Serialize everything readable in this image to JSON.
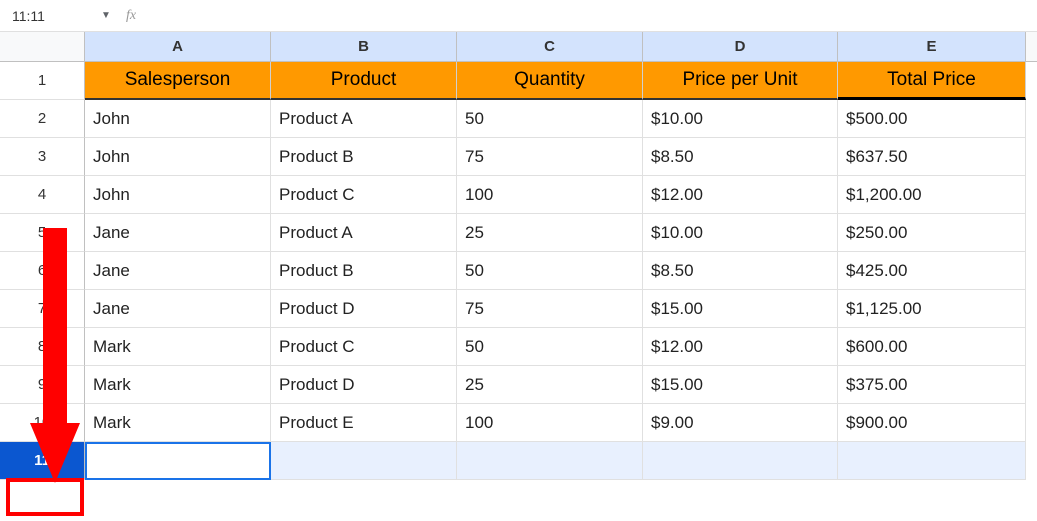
{
  "nameBox": "11:11",
  "fxLabel": "fx",
  "formulaValue": "",
  "columns": [
    "A",
    "B",
    "C",
    "D",
    "E"
  ],
  "rowNumbers": [
    "1",
    "2",
    "3",
    "4",
    "5",
    "6",
    "7",
    "8",
    "9",
    "10",
    "11"
  ],
  "selectedRow": 11,
  "headers": {
    "c0": "Salesperson",
    "c1": "Product",
    "c2": "Quantity",
    "c3": "Price per Unit",
    "c4": "Total Price"
  },
  "rows": [
    {
      "c0": "John",
      "c1": "Product A",
      "c2": "50",
      "c3": "$10.00",
      "c4": "$500.00"
    },
    {
      "c0": "John",
      "c1": "Product B",
      "c2": "75",
      "c3": "$8.50",
      "c4": "$637.50"
    },
    {
      "c0": "John",
      "c1": "Product C",
      "c2": "100",
      "c3": "$12.00",
      "c4": "$1,200.00"
    },
    {
      "c0": "Jane",
      "c1": "Product A",
      "c2": "25",
      "c3": "$10.00",
      "c4": "$250.00"
    },
    {
      "c0": "Jane",
      "c1": "Product B",
      "c2": "50",
      "c3": "$8.50",
      "c4": "$425.00"
    },
    {
      "c0": "Jane",
      "c1": "Product D",
      "c2": "75",
      "c3": "$15.00",
      "c4": "$1,125.00"
    },
    {
      "c0": "Mark",
      "c1": "Product C",
      "c2": "50",
      "c3": "$12.00",
      "c4": "$600.00"
    },
    {
      "c0": "Mark",
      "c1": "Product D",
      "c2": "25",
      "c3": "$15.00",
      "c4": "$375.00"
    },
    {
      "c0": "Mark",
      "c1": "Product E",
      "c2": "100",
      "c3": "$9.00",
      "c4": "$900.00"
    }
  ],
  "chart_data": {
    "type": "table",
    "title": "",
    "columns": [
      "Salesperson",
      "Product",
      "Quantity",
      "Price per Unit",
      "Total Price"
    ],
    "data": [
      [
        "John",
        "Product A",
        50,
        10.0,
        500.0
      ],
      [
        "John",
        "Product B",
        75,
        8.5,
        637.5
      ],
      [
        "John",
        "Product C",
        100,
        12.0,
        1200.0
      ],
      [
        "Jane",
        "Product A",
        25,
        10.0,
        250.0
      ],
      [
        "Jane",
        "Product B",
        50,
        8.5,
        425.0
      ],
      [
        "Jane",
        "Product D",
        75,
        15.0,
        1125.0
      ],
      [
        "Mark",
        "Product C",
        50,
        12.0,
        600.0
      ],
      [
        "Mark",
        "Product D",
        25,
        15.0,
        375.0
      ],
      [
        "Mark",
        "Product E",
        100,
        9.0,
        900.0
      ]
    ]
  }
}
